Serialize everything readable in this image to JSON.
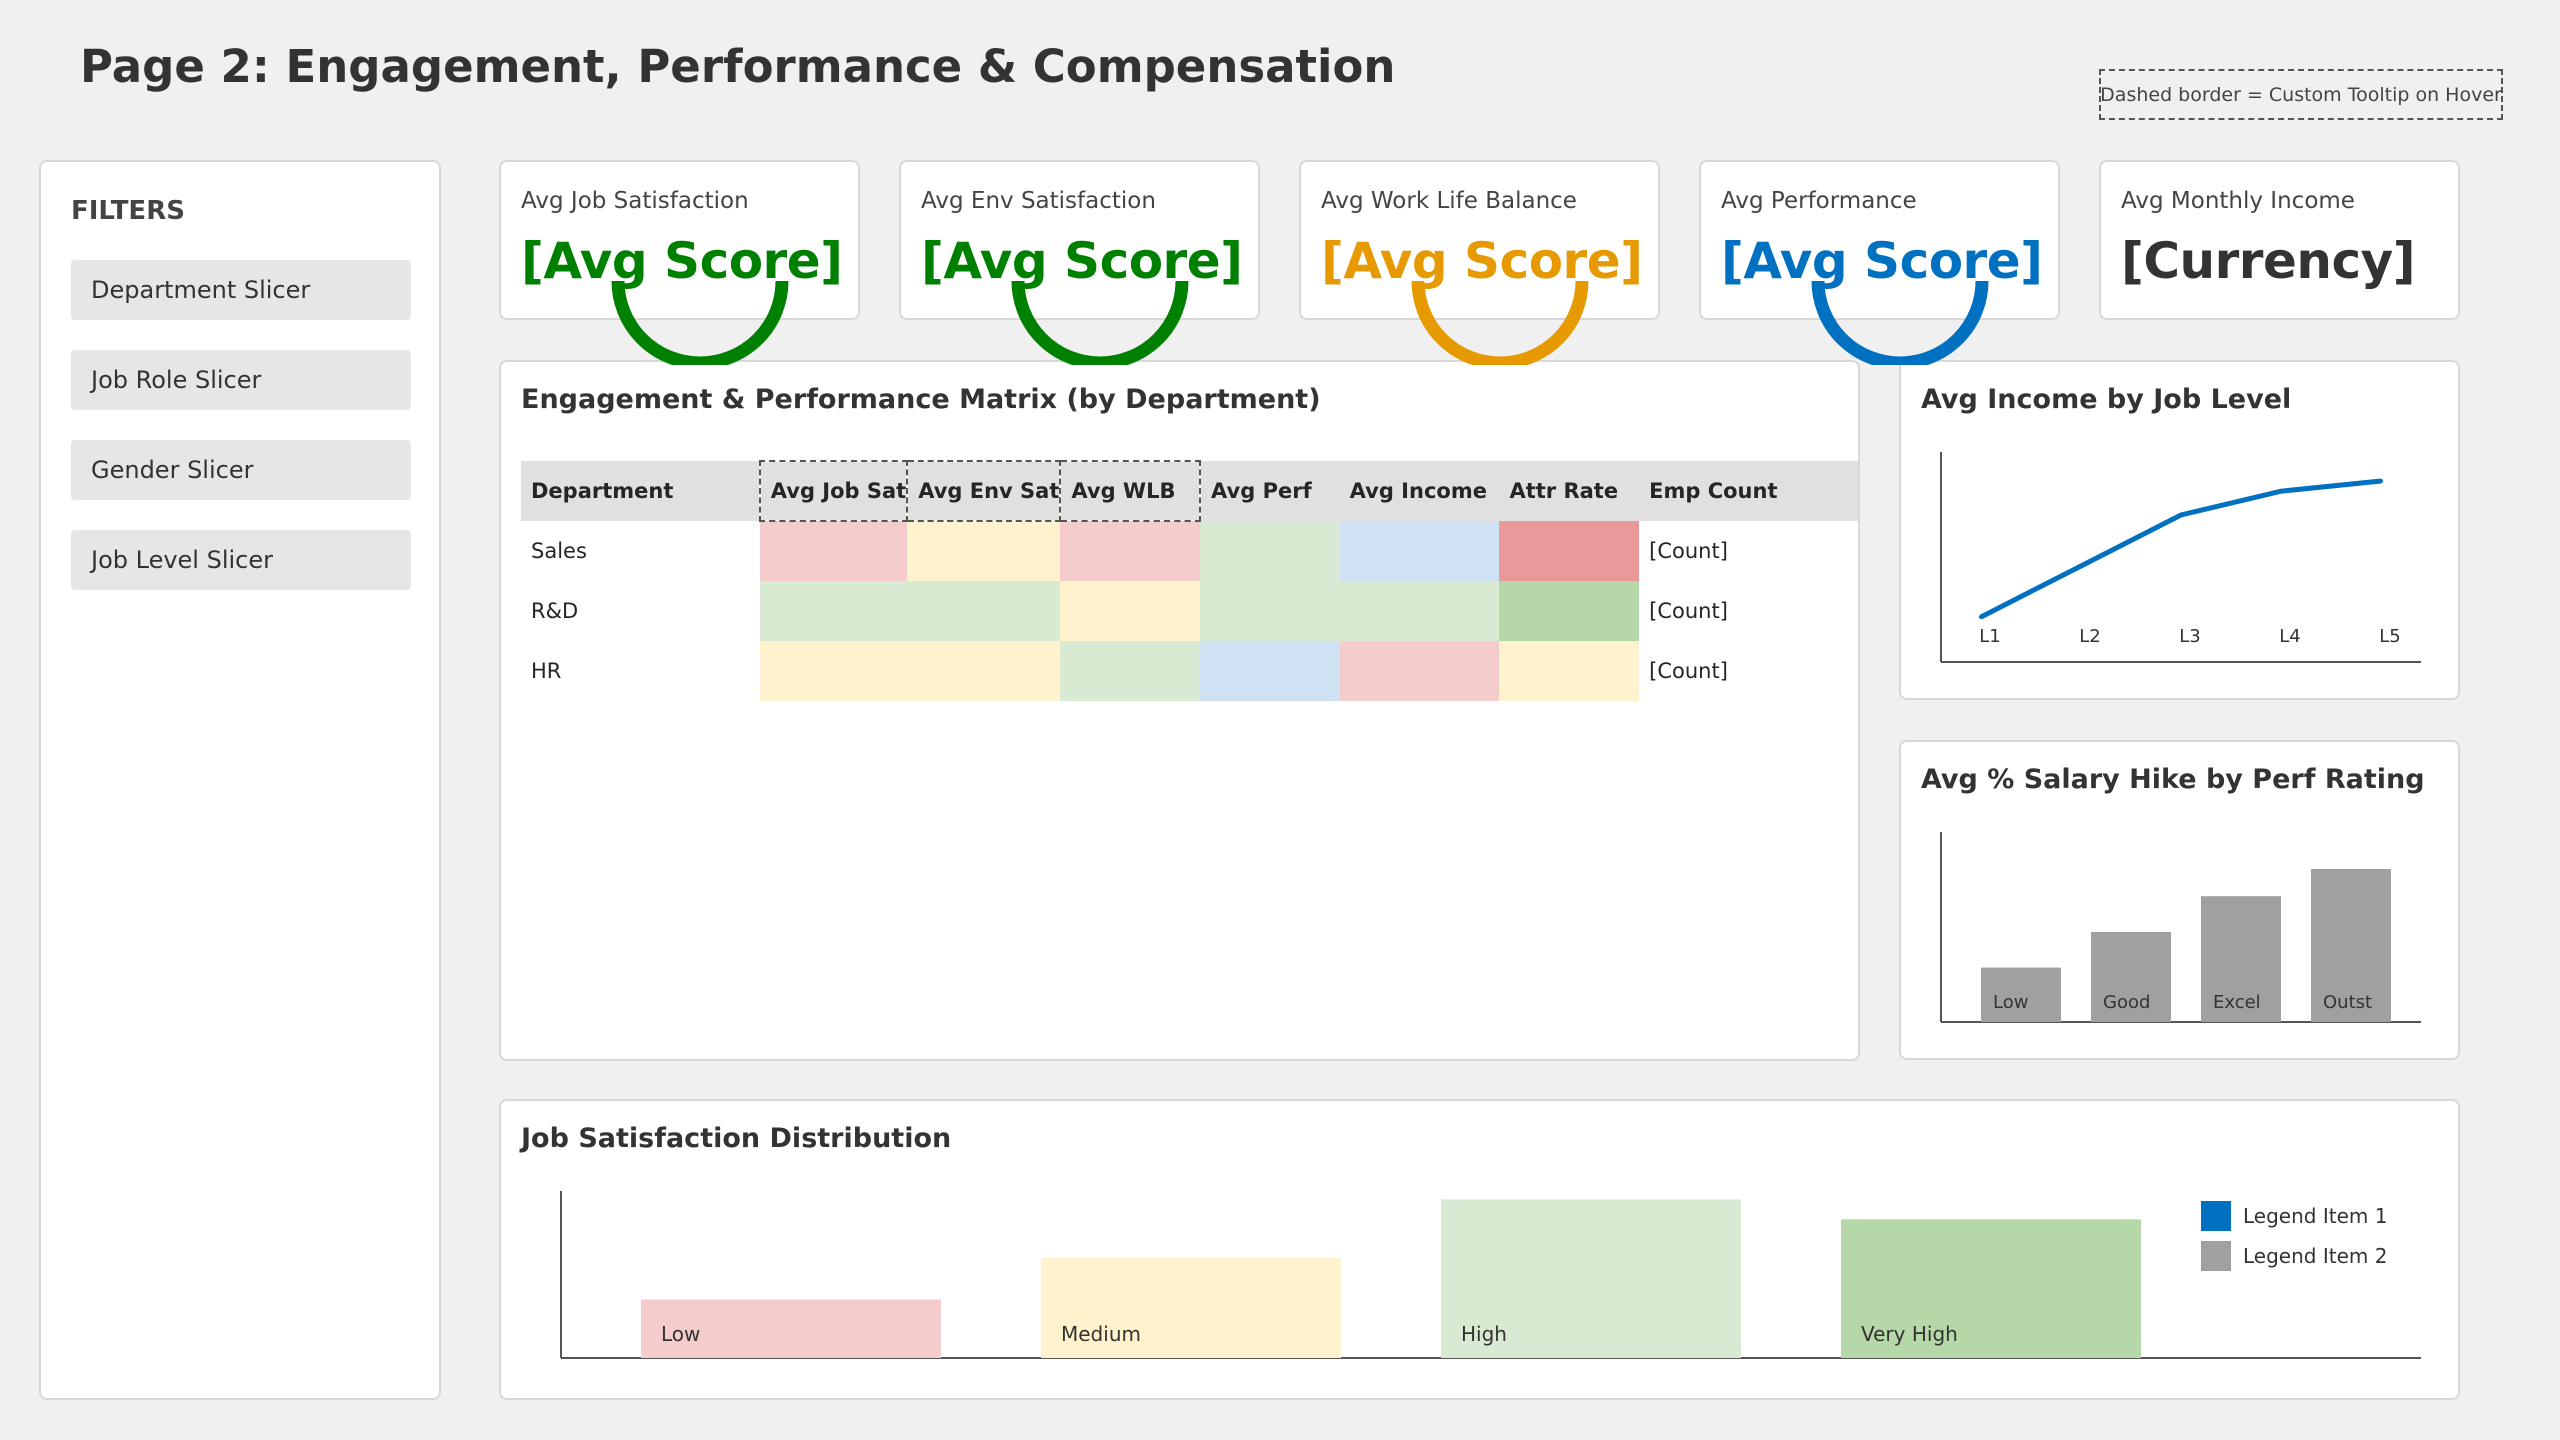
{
  "page": {
    "title": "Page 2: Engagement, Performance & Compensation",
    "tooltip_note": "Dashed border = Custom Tooltip on Hover"
  },
  "filters": {
    "title": "FILTERS",
    "slicers": [
      "Department Slicer",
      "Job Role Slicer",
      "Gender Slicer",
      "Job Level Slicer"
    ]
  },
  "kpis": [
    {
      "label": "Avg Job Satisfaction",
      "value": "[Avg Score]",
      "color": "#008000",
      "gauge": true
    },
    {
      "label": "Avg Env Satisfaction",
      "value": "[Avg Score]",
      "color": "#008000",
      "gauge": true
    },
    {
      "label": "Avg Work Life Balance",
      "value": "[Avg Score]",
      "color": "#e69900",
      "gauge": true
    },
    {
      "label": "Avg Performance",
      "value": "[Avg Score]",
      "color": "#0070c0",
      "gauge": true
    },
    {
      "label": "Avg Monthly Income",
      "value": "[Currency]",
      "color": "#333333",
      "gauge": false
    }
  ],
  "matrix": {
    "title": "Engagement & Performance Matrix (by Department)",
    "headers": [
      "Department",
      "Avg Job Sat",
      "Avg Env Sat",
      "Avg WLB",
      "Avg Perf",
      "Avg Income",
      "Attr Rate",
      "Emp Count"
    ],
    "rows": [
      {
        "dept": "Sales",
        "count": "[Count]"
      },
      {
        "dept": "R&D",
        "count": "[Count]"
      },
      {
        "dept": "HR",
        "count": "[Count]"
      }
    ],
    "colors": {
      "red": "#f4cccc",
      "yellow": "#fff2cc",
      "green": "#d9ead3",
      "blue": "#cfe2f3",
      "dark_red": "#ea9999",
      "dark_green": "#b6d7a8"
    }
  },
  "income_chart": {
    "title": "Avg Income by Job Level"
  },
  "hike_chart": {
    "title": "Avg % Salary Hike by Perf Rating"
  },
  "satisfaction_chart": {
    "title": "Job Satisfaction Distribution",
    "legend": [
      "Legend Item 1",
      "Legend Item 2"
    ],
    "legend_colors": [
      "#0070c0",
      "#a0a0a0"
    ]
  },
  "chart_data": [
    {
      "type": "line",
      "title": "Avg Income by Job Level",
      "categories": [
        "L1",
        "L2",
        "L3",
        "L4",
        "L5"
      ],
      "values": [
        0,
        30,
        60,
        74,
        80
      ],
      "ylim": [
        0,
        100
      ],
      "color": "#0070c0"
    },
    {
      "type": "bar",
      "title": "Avg % Salary Hike by Perf Rating",
      "categories": [
        "Low",
        "Good",
        "Excel",
        "Outst"
      ],
      "values": [
        32,
        53,
        74,
        90
      ],
      "ylim": [
        0,
        100
      ],
      "color": "#a0a0a0"
    },
    {
      "type": "bar",
      "title": "Job Satisfaction Distribution",
      "categories": [
        "Low",
        "Medium",
        "High",
        "Very High"
      ],
      "values": [
        35,
        60,
        95,
        83
      ],
      "ylim": [
        0,
        100
      ],
      "colors": [
        "#f4cccc",
        "#fff2cc",
        "#d9ead3",
        "#b6d7a8"
      ]
    }
  ]
}
